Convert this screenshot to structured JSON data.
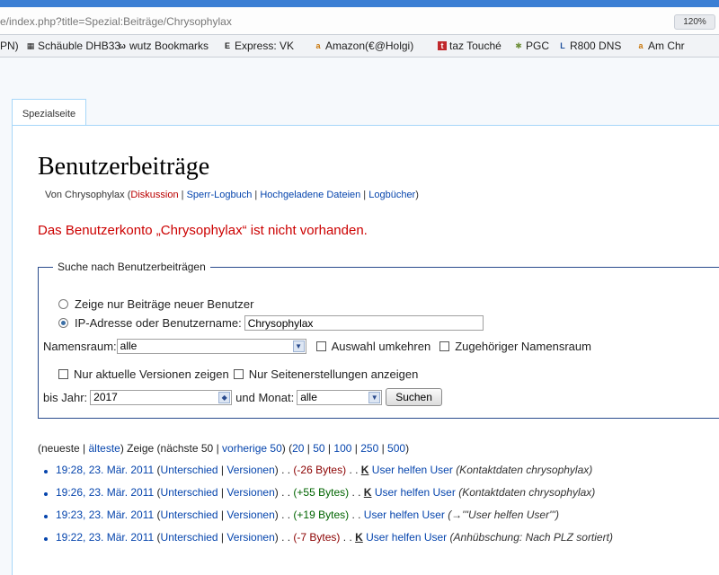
{
  "browser": {
    "url": "e/index.php?title=Spezial:Beiträge/Chrysophylax",
    "zoom": "120%"
  },
  "bookmarks": [
    {
      "label": "PN)",
      "icon": ""
    },
    {
      "label": "Schäuble DHB33",
      "icon": "calendar-icon"
    },
    {
      "label": "wutz Bookmarks",
      "icon": "glasses-icon"
    },
    {
      "label": "Express: VK",
      "icon": "express-icon"
    },
    {
      "label": "Amazon(€@Holgi)",
      "icon": "amazon-icon"
    },
    {
      "label": "taz Touché",
      "icon": "taz-icon"
    },
    {
      "label": "PGC",
      "icon": "star-icon"
    },
    {
      "label": "R800 DNS",
      "icon": "l-icon"
    },
    {
      "label": "Am Chr",
      "icon": "amazon-icon"
    }
  ],
  "page": {
    "tab": "Spezialseite",
    "title": "Benutzerbeiträge",
    "subline": {
      "prefix": "Von Chrysophylax (",
      "diskussion": "Diskussion",
      "sep1": " | ",
      "sperr": "Sperr-Logbuch",
      "sep2": " | ",
      "uploads": "Hochgeladene Dateien",
      "sep3": " | ",
      "logs": "Logbücher",
      "suffix": ")"
    },
    "error": "Das Benutzerkonto „Chrysophylax“ ist nicht vorhanden."
  },
  "search": {
    "legend": "Suche nach Benutzerbeiträgen",
    "radio_new_users": "Zeige nur Beiträge neuer Benutzer",
    "radio_ip_user": "IP-Adresse oder Benutzername:",
    "username_value": "Chrysophylax",
    "namespace_label": "Namensraum:",
    "namespace_value": "alle",
    "invert_label": "Auswahl umkehren",
    "associated_label": "Zugehöriger Namensraum",
    "current_only_label": "Nur aktuelle Versionen zeigen",
    "creations_only_label": "Nur Seitenerstellungen anzeigen",
    "year_label": "bis Jahr:",
    "year_value": "2017",
    "month_label": "und Monat:",
    "month_value": "alle",
    "submit_label": "Suchen"
  },
  "nav": {
    "t1": "(neueste | ",
    "oldest": "älteste",
    "t2": ") Zeige (nächste 50 | ",
    "prev": "vorherige 50",
    "t3": ") (",
    "n20": "20",
    "sep": " | ",
    "n50": "50",
    "n100": "100",
    "n250": "250",
    "n500": "500",
    "t4": ")"
  },
  "contribs": [
    {
      "time": "19:28, 23. Mär. 2011",
      "diff": "Unterschied",
      "hist": "Versionen",
      "bytes": "(-26 Bytes)",
      "minor": "K",
      "page": "User helfen User",
      "summary": "(Kontaktdaten chrysophylax)"
    },
    {
      "time": "19:26, 23. Mär. 2011",
      "diff": "Unterschied",
      "hist": "Versionen",
      "bytes": "(+55 Bytes)",
      "minor": "K",
      "page": "User helfen User",
      "summary": "(Kontaktdaten chrysophylax)"
    },
    {
      "time": "19:23, 23. Mär. 2011",
      "diff": "Unterschied",
      "hist": "Versionen",
      "bytes": "(+19 Bytes)",
      "minor": "",
      "page": "User helfen User",
      "summary": "(→'''User helfen User''')"
    },
    {
      "time": "19:22, 23. Mär. 2011",
      "diff": "Unterschied",
      "hist": "Versionen",
      "bytes": "(-7 Bytes)",
      "minor": "K",
      "page": "User helfen User",
      "summary": "(Anhübschung: Nach PLZ sortiert)"
    }
  ],
  "contrib_fixed": {
    "open": " (",
    "pipe": " | ",
    "close": ") . . ",
    "dots": " . . "
  }
}
